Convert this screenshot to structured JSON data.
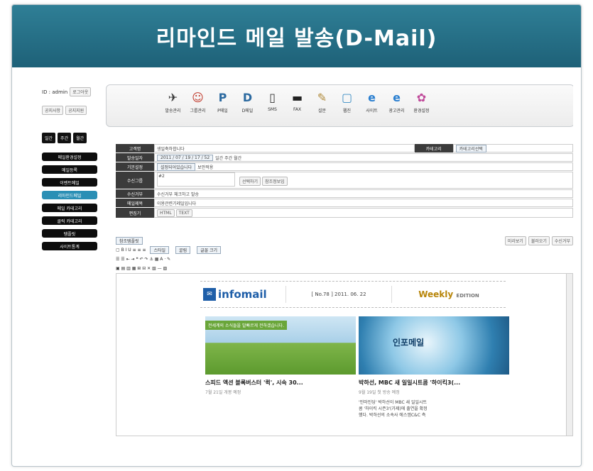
{
  "banner": {
    "title": "리마인드 메일 발송(D-Mail)"
  },
  "login": {
    "user": "ID : admin",
    "logout": "로그아웃",
    "notice": "공지사항",
    "help": "공지지원"
  },
  "toolbar_icons": [
    {
      "label": "발송관리",
      "icon": "send-icon"
    },
    {
      "label": "그룹관리",
      "icon": "group-icon"
    },
    {
      "label": "P메일",
      "icon": "p-mail-icon"
    },
    {
      "label": "D메일",
      "icon": "d-mail-icon"
    },
    {
      "label": "SMS",
      "icon": "sms-icon"
    },
    {
      "label": "FAX",
      "icon": "fax-icon"
    },
    {
      "label": "설문",
      "icon": "survey-icon"
    },
    {
      "label": "웹진",
      "icon": "webzine-icon"
    },
    {
      "label": "사이트",
      "icon": "site-icon"
    },
    {
      "label": "광고관리",
      "icon": "ad-icon"
    },
    {
      "label": "환경설정",
      "icon": "settings-icon"
    }
  ],
  "period_buttons": [
    "일간",
    "주간",
    "월간"
  ],
  "side_menu": [
    {
      "label": "메일환경설정",
      "active": false
    },
    {
      "label": "메일등록",
      "active": false
    },
    {
      "label": "이벤트메일",
      "active": false
    },
    {
      "label": "리마인드메일",
      "active": true
    },
    {
      "label": "메일 카테고리",
      "active": false
    },
    {
      "label": "클릭 카테고리",
      "active": false
    },
    {
      "label": "템플릿",
      "active": false
    },
    {
      "label": "사이트통계",
      "active": false
    }
  ],
  "form": {
    "title_label": "고객명",
    "title_value": "생일축하합니다",
    "category_label": "카테고리",
    "category_value": "카테고리선택",
    "date_label": "발송일자",
    "date_value": "2011 / 07 / 19 / 17 / 52",
    "cycle": "일간 주간 월간",
    "basic_label": "기본설정",
    "basic_value": "설정되어있습니다",
    "apply": "보안적용",
    "group_label": "수신그룹",
    "group_value": "#2",
    "group_btn1": "선택하기",
    "group_btn2": "참조정보입",
    "reject_label": "수신거부",
    "reject_value": "수신거부 체크하고 발송",
    "subject_label": "메일제목",
    "subject_value": "이용관련기레일입니다",
    "editor_label": "편집기",
    "editor_tab1": "HTML",
    "editor_tab2": "TEXT"
  },
  "editor_toolbar": {
    "template": "참조템플릿",
    "style": "스타일",
    "font": "굴림",
    "size": "글꼴 크기",
    "preview": "미리보기",
    "save": "불러오기",
    "cancel": "수신거부"
  },
  "newsletter": {
    "brand": "infomail",
    "issue": "[ No.78 ] 2011. 06. 22",
    "weekly": "Weekly",
    "edition": "EDITION",
    "card1": {
      "caption": "전세계의 소식들을 발빠르게 전하겠습니다.",
      "title": "스피드 액션 블록버스터 '퀵', 시속 30...",
      "date": "7월 21일 개봉 예정"
    },
    "card2": {
      "caption": "인포메일",
      "title": "박하선, MBC 새 일일시트콤 '하이킥3(...",
      "date": "9월 19일 첫 방송 예정",
      "desc": "'인마인딩' 박하선이 MBC 새 일일시트콤 '하이킥 시즌3'(가제)에 출연을 확정했다. 박하선의 소속사 에스엠C&C 측"
    }
  }
}
